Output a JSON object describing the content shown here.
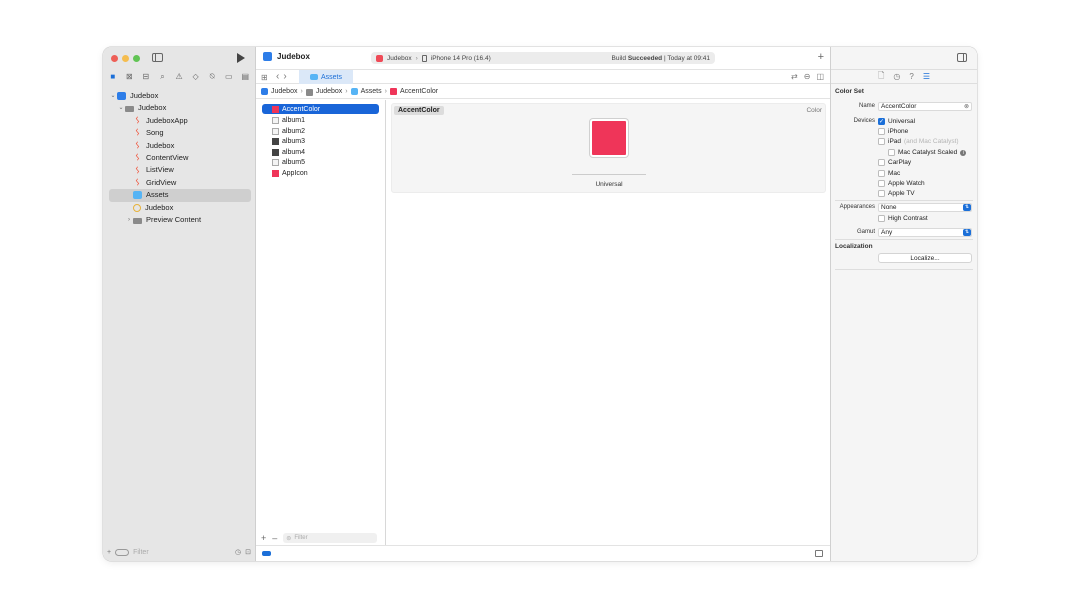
{
  "navigator": {
    "tree": [
      {
        "label": "Judebox",
        "icon": "project-icon"
      },
      {
        "label": "Judebox",
        "icon": "folder-icon"
      },
      {
        "label": "JudeboxApp",
        "icon": "swift-file-icon"
      },
      {
        "label": "Song",
        "icon": "swift-file-icon"
      },
      {
        "label": "Judebox",
        "icon": "swift-file-icon"
      },
      {
        "label": "ContentView",
        "icon": "swift-file-icon"
      },
      {
        "label": "ListView",
        "icon": "swift-file-icon"
      },
      {
        "label": "GridView",
        "icon": "swift-file-icon"
      },
      {
        "label": "Assets",
        "icon": "asset-catalog-icon"
      },
      {
        "label": "Judebox",
        "icon": "entitlements-icon"
      },
      {
        "label": "Preview Content",
        "icon": "folder-icon"
      }
    ],
    "filter_placeholder": "Filter"
  },
  "toolbar": {
    "project_name": "Judebox",
    "scheme": "Judebox",
    "device": "iPhone 14 Pro (16.4)",
    "status_prefix": "Build",
    "status_bold": "Succeeded",
    "status_suffix": "| Today at 09:41"
  },
  "tab": {
    "label": "Assets"
  },
  "jumpbar": [
    "Judebox",
    "Judebox",
    "Assets",
    "AccentColor"
  ],
  "assets": {
    "items": [
      "AccentColor",
      "album1",
      "album2",
      "album3",
      "album4",
      "album5",
      "AppIcon"
    ],
    "filter_placeholder": "Filter"
  },
  "color_set": {
    "name": "AccentColor",
    "kind": "Color",
    "swatch_color": "#EF3559",
    "swatch_label": "Universal"
  },
  "inspector": {
    "section_title": "Color Set",
    "name_label": "Name",
    "name_value": "AccentColor",
    "devices_label": "Devices",
    "devices": [
      {
        "label": "Universal",
        "checked": true
      },
      {
        "label": "iPhone",
        "checked": false
      },
      {
        "label": "iPad",
        "note": "(and Mac Catalyst)",
        "checked": false
      },
      {
        "label": "Mac Catalyst Scaled",
        "checked": false
      },
      {
        "label": "CarPlay",
        "checked": false
      },
      {
        "label": "Mac",
        "checked": false
      },
      {
        "label": "Apple Watch",
        "checked": false
      },
      {
        "label": "Apple TV",
        "checked": false
      }
    ],
    "appearances_label": "Appearances",
    "appearances_value": "None",
    "high_contrast_label": "High Contrast",
    "gamut_label": "Gamut",
    "gamut_value": "Any",
    "localization_title": "Localization",
    "localize_button": "Localize..."
  },
  "colors": {
    "accent": "#1B6FD8",
    "swatch": "#EF3559"
  }
}
